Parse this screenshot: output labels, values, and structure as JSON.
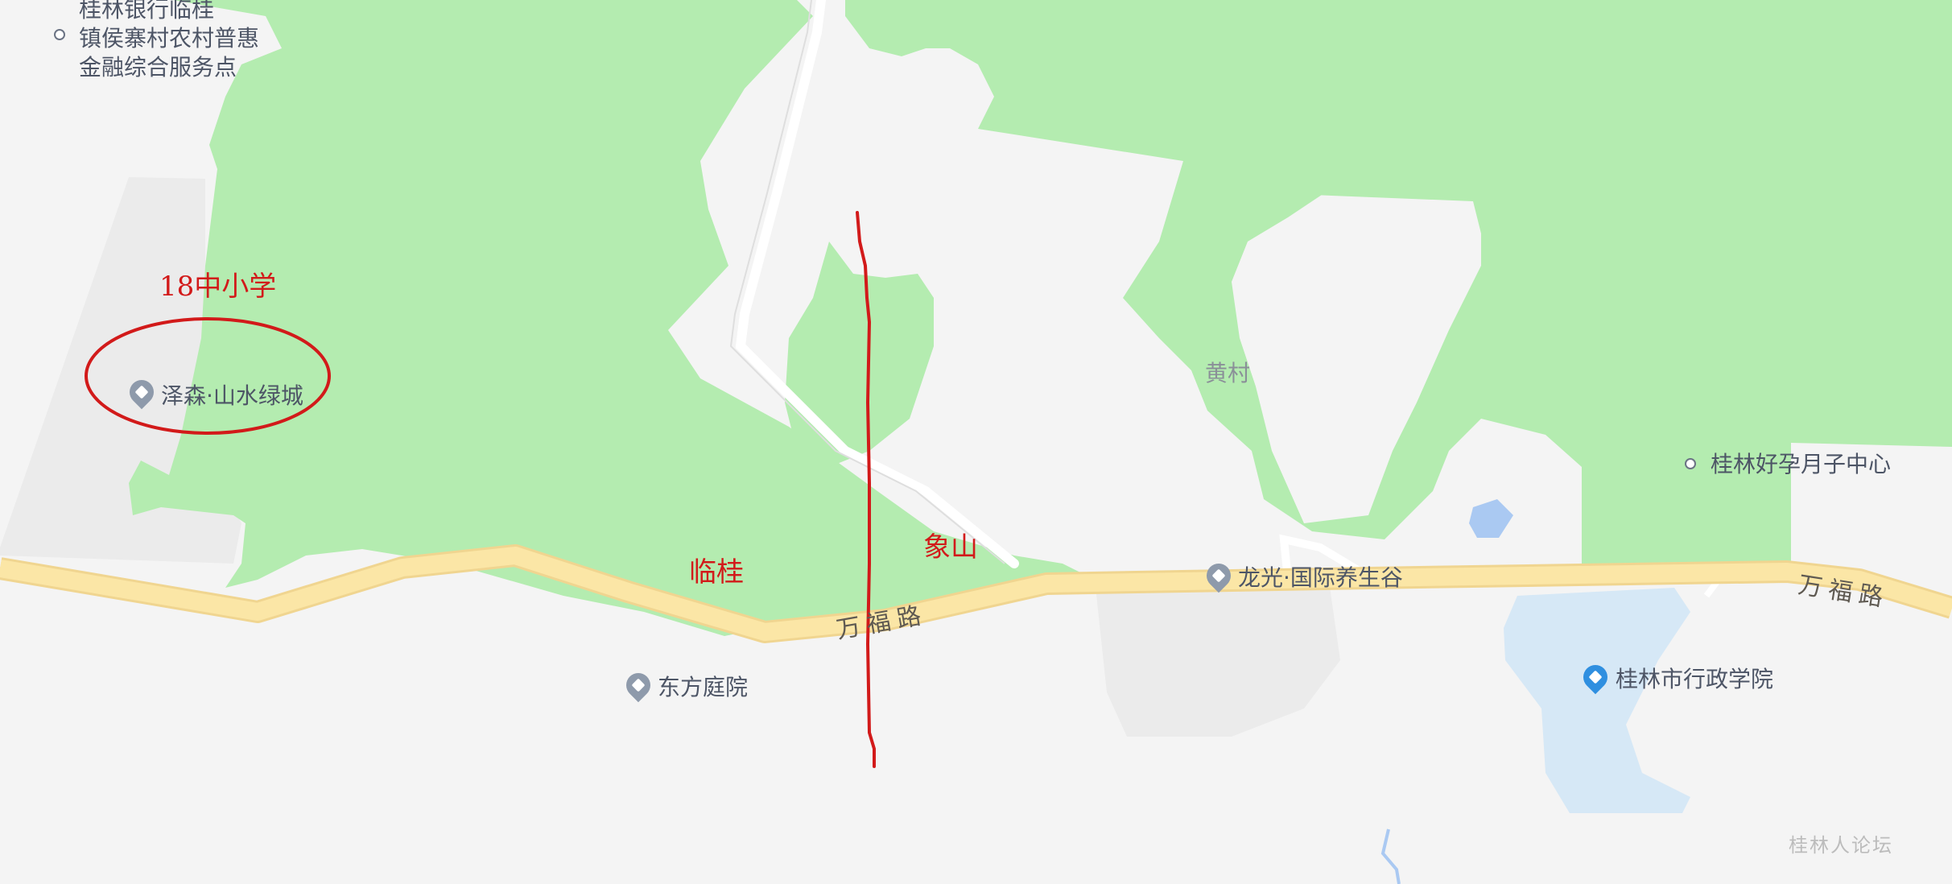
{
  "colors": {
    "background": "#f4f4f4",
    "greenery": "#b4ecb0",
    "main_road_fill": "#fbe6a6",
    "main_road_edge": "#f0d590",
    "water": "#d6e8f6",
    "annotation_red": "#d21a1a"
  },
  "pois": {
    "bank": "桂林银行临桂镇侯寨村农村普惠金融综合服务点",
    "bank_lines": [
      "桂林银行临桂",
      "镇侯寨村农村普惠",
      "金融综合服务点"
    ],
    "zesen": "泽森·山水绿城",
    "dongfang": "东方庭院",
    "longguang": "龙光·国际养生谷",
    "yuezi": "桂林好孕月子中心",
    "xingzheng": "桂林市行政学院"
  },
  "villages": {
    "huangcun": "黄村"
  },
  "roads": {
    "wanfu_1": "万福路",
    "wanfu_2": "万福路"
  },
  "annotations": {
    "school": "18中小学",
    "lingui": "临桂",
    "xiangshan": "象山"
  },
  "watermark": "桂林人论坛",
  "icons": {
    "poi_marker": "map-pin-icon",
    "school_marker": "school-pin-icon",
    "small_poi": "circle-dot-icon"
  }
}
